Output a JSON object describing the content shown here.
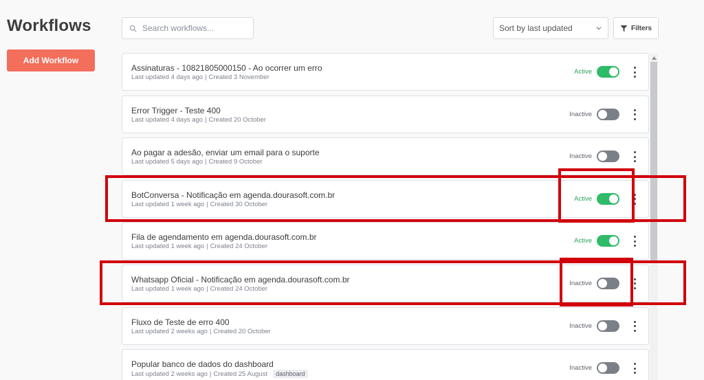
{
  "page": {
    "title": "Workflows"
  },
  "actions": {
    "add_workflow": "Add Workflow"
  },
  "search": {
    "placeholder": "Search workflows...",
    "icon": "search-icon"
  },
  "sort": {
    "value": "Sort by last updated",
    "icon": "chevron-down-icon"
  },
  "filters": {
    "label": "Filters",
    "icon": "funnel-icon"
  },
  "colors": {
    "accent": "#f36e5b",
    "active": "#2fbb68",
    "inactive_toggle": "#7b7f87",
    "highlight": "#d1000a"
  },
  "workflows": [
    {
      "name": "Assinaturas - 10821805000150 - Ao ocorrer um erro",
      "updated": "Last updated 4 days ago",
      "created": "Created 3 November",
      "status": "Active",
      "enabled": true
    },
    {
      "name": "Error Trigger - Teste 400",
      "updated": "Last updated 4 days ago",
      "created": "Created 20 October",
      "status": "Inactive",
      "enabled": false
    },
    {
      "name": "Ao pagar a adesão, enviar um email para o suporte",
      "updated": "Last updated 5 days ago",
      "created": "Created 9 October",
      "status": "Inactive",
      "enabled": false
    },
    {
      "name": "BotConversa - Notificação em agenda.dourasoft.com.br",
      "updated": "Last updated 1 week ago",
      "created": "Created 30 October",
      "status": "Active",
      "enabled": true
    },
    {
      "name": "Fila de agendamento em agenda.dourasoft.com.br",
      "updated": "Last updated 1 week ago",
      "created": "Created 24 October",
      "status": "Active",
      "enabled": true
    },
    {
      "name": "Whatsapp Oficial - Notificação em agenda.dourasoft.com.br",
      "updated": "Last updated 1 week ago",
      "created": "Created 24 October",
      "status": "Inactive",
      "enabled": false
    },
    {
      "name": "Fluxo de Teste de erro 400",
      "updated": "Last updated 2 weeks ago",
      "created": "Created 20 October",
      "status": "Inactive",
      "enabled": false
    },
    {
      "name": "Popular banco de dados do dashboard",
      "updated": "Last updated 2 weeks ago",
      "created": "Created 25 August",
      "status": "Inactive",
      "enabled": false,
      "tag": "dashboard"
    }
  ],
  "meta_separator": "|"
}
